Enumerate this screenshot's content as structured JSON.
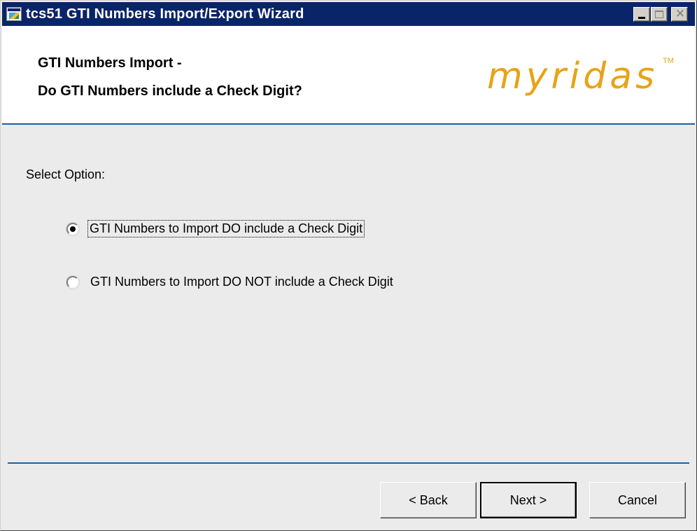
{
  "window": {
    "title": "tcs51 GTI Numbers Import/Export Wizard",
    "icons": {
      "app": "app-window-icon",
      "minimize": "minimize-icon",
      "maximize": "maximize-icon",
      "close": "close-icon"
    },
    "close_glyph": "✕"
  },
  "header": {
    "line1": "GTI Numbers Import -",
    "line2": "Do GTI Numbers include a Check Digit?",
    "brand": "myridas",
    "trademark": "TM",
    "brand_color": "#e8a317"
  },
  "body": {
    "prompt": "Select Option:",
    "options": [
      {
        "label": "GTI Numbers to Import DO include a Check Digit",
        "selected": true
      },
      {
        "label": "GTI Numbers to Import DO NOT include a Check Digit",
        "selected": false
      }
    ]
  },
  "buttons": {
    "back": "< Back",
    "next": "Next >",
    "cancel": "Cancel"
  },
  "colors": {
    "titlebar": "#0a246a",
    "accent_line": "#1e5fa8",
    "dialog_bg": "#ecebeb"
  }
}
